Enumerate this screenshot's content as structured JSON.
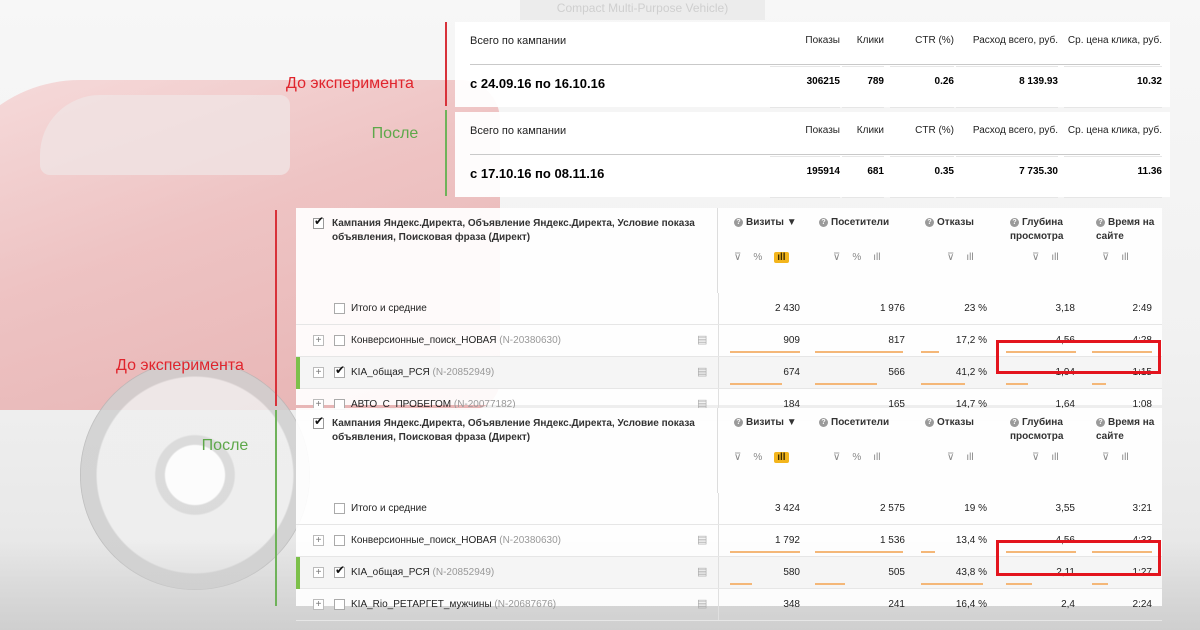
{
  "background": {
    "tag_text": "Compact Multi-Purpose Vehicle)"
  },
  "labels": {
    "before": "До эксперимента",
    "after": "После"
  },
  "summary_before": {
    "headers": [
      "Всего по кампании",
      "Показы",
      "Клики",
      "CTR (%)",
      "Расход всего, руб.",
      "Ср. цена клика, руб."
    ],
    "values": [
      "с 24.09.16 по 16.10.16",
      "306215",
      "789",
      "0.26",
      "8 139.93",
      "10.32"
    ]
  },
  "summary_after": {
    "headers": [
      "Всего по кампании",
      "Показы",
      "Клики",
      "CTR (%)",
      "Расход всего, руб.",
      "Ср. цена клика, руб."
    ],
    "values": [
      "с 17.10.16 по 08.11.16",
      "195914",
      "681",
      "0.35",
      "7 735.30",
      "11.36"
    ]
  },
  "report_header": {
    "grouping": "Кампания Яндекс.Директа, Объявление Яндекс.Директа, Условие показа объявления, Поисковая фраза (Директ)",
    "metrics": [
      "Визиты",
      "Посетители",
      "Отказы",
      "Глубина просмотра",
      "Время на сайте"
    ],
    "sort_marker": "▼",
    "help_icon": "?",
    "tool_icons": {
      "filter": "⊽",
      "percent": "%",
      "bars": "ıll"
    }
  },
  "report_before": {
    "rows": [
      {
        "name": "Итого и средние",
        "id": "",
        "visits": "2 430",
        "visitors": "1 976",
        "bounce": "23 %",
        "depth": "3,18",
        "time": "2:49"
      },
      {
        "name": "Конверсионные_поиск_НОВАЯ",
        "id": "(N-20380630)",
        "visits": "909",
        "visitors": "817",
        "bounce": "17,2 %",
        "depth": "4,56",
        "time": "4:28"
      },
      {
        "name": "KIA_общая_РСЯ",
        "id": "(N-20852949)",
        "visits": "674",
        "visitors": "566",
        "bounce": "41,2 %",
        "depth": "1,94",
        "time": "1:15"
      },
      {
        "name": "АВТО_С_ПРОБЕГОМ",
        "id": "(N-20077182)",
        "visits": "184",
        "visitors": "165",
        "bounce": "14,7 %",
        "depth": "1,64",
        "time": "1:08"
      }
    ]
  },
  "report_after": {
    "rows": [
      {
        "name": "Итого и средние",
        "id": "",
        "visits": "3 424",
        "visitors": "2 575",
        "bounce": "19 %",
        "depth": "3,55",
        "time": "3:21"
      },
      {
        "name": "Конверсионные_поиск_НОВАЯ",
        "id": "(N-20380630)",
        "visits": "1 792",
        "visitors": "1 536",
        "bounce": "13,4 %",
        "depth": "4,56",
        "time": "4:33"
      },
      {
        "name": "KIA_общая_РСЯ",
        "id": "(N-20852949)",
        "visits": "580",
        "visitors": "505",
        "bounce": "43,8 %",
        "depth": "2,11",
        "time": "1:27"
      },
      {
        "name": "KIA_Rio_РЕТАРГЕТ_мужчины",
        "id": "(N-20687676)",
        "visits": "348",
        "visitors": "241",
        "bounce": "16,4 %",
        "depth": "2,4",
        "time": "2:24"
      }
    ]
  },
  "colors": {
    "red": "#e0242c",
    "green": "#5ea84a",
    "highlight": "#e3141d",
    "accent": "#f3b51c"
  }
}
